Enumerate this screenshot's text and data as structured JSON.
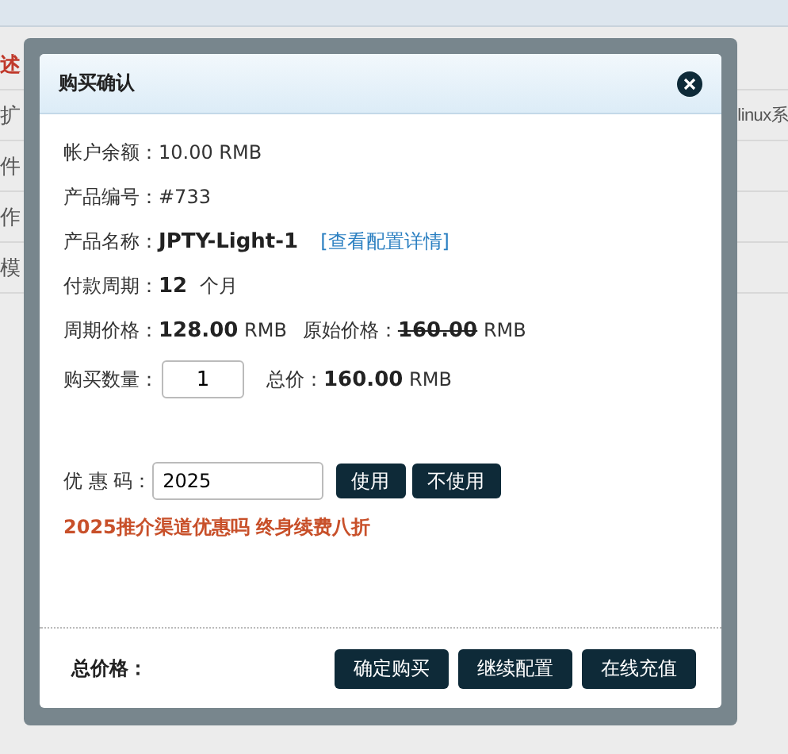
{
  "background": {
    "rows": [
      {
        "left": "述",
        "right": "",
        "alert": true
      },
      {
        "left": "扩",
        "right": "linux系",
        "alert": false
      },
      {
        "left": "件",
        "right": "",
        "alert": false
      },
      {
        "left": "作",
        "right": "",
        "alert": false
      },
      {
        "left": "模",
        "right": "",
        "alert": false
      }
    ]
  },
  "dialog": {
    "title": "购买确认",
    "balance": {
      "label": "帐户余额：",
      "value": "10.00 RMB"
    },
    "product_id": {
      "label": "产品编号：",
      "value": "#733"
    },
    "product_name": {
      "label": "产品名称：",
      "value": "JPTY-Light-1",
      "link": "[查看配置详情]"
    },
    "period": {
      "label": "付款周期：",
      "value": "12",
      "unit": "个月"
    },
    "price": {
      "label": "周期价格：",
      "value": "128.00",
      "unit": "RMB",
      "original_label": "原始价格：",
      "original_value": "160.00",
      "original_unit": "RMB"
    },
    "quantity": {
      "label": "购买数量：",
      "value": "1",
      "total_label": "总价：",
      "total_value": "160.00",
      "total_unit": "RMB"
    },
    "coupon": {
      "label": "优 惠 码：",
      "value": "2025",
      "buttons": [
        "使用",
        "不使用"
      ]
    },
    "notice": "2025推介渠道优惠吗 终身续费八折",
    "footer": {
      "label": "总价格：",
      "buttons": [
        "确定购买",
        "继续配置",
        "在线充值"
      ]
    }
  }
}
